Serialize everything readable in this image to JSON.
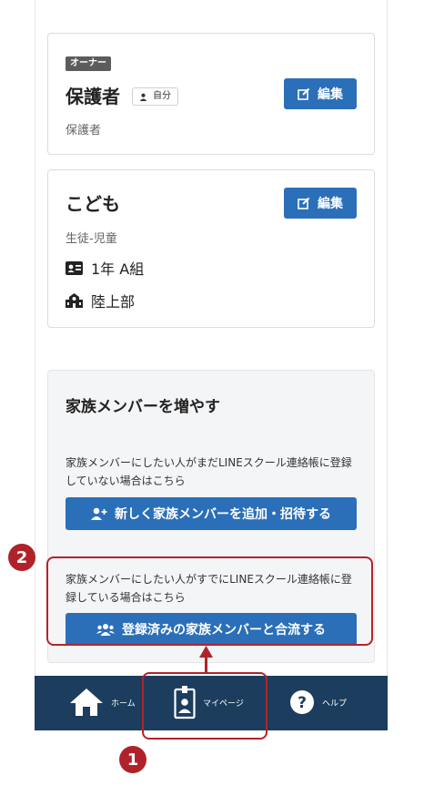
{
  "owner_card": {
    "badge": "オーナー",
    "name": "保護者",
    "self_tag": "自分",
    "role": "保護者",
    "edit_label": "編集"
  },
  "child_card": {
    "name": "こども",
    "role": "生徒-児童",
    "class": "1年 A組",
    "club": "陸上部",
    "edit_label": "編集"
  },
  "add_family": {
    "title": "家族メンバーを増やす",
    "invite_desc": "家族メンバーにしたい人がまだLINEスクール連絡帳に登録していない場合はこちら",
    "invite_button": "新しく家族メンバーを追加・招待する",
    "merge_desc": "家族メンバーにしたい人がすでにLINEスクール連絡帳に登録している場合はこちら",
    "merge_button": "登録済みの家族メンバーと合流する"
  },
  "annotations": {
    "step1": "1",
    "step2": "2",
    "accent_color": "#b0222a"
  },
  "bottom_nav": {
    "home": "ホーム",
    "mypage": "マイページ",
    "help": "ヘルプ",
    "background": "#1c3d5e"
  }
}
